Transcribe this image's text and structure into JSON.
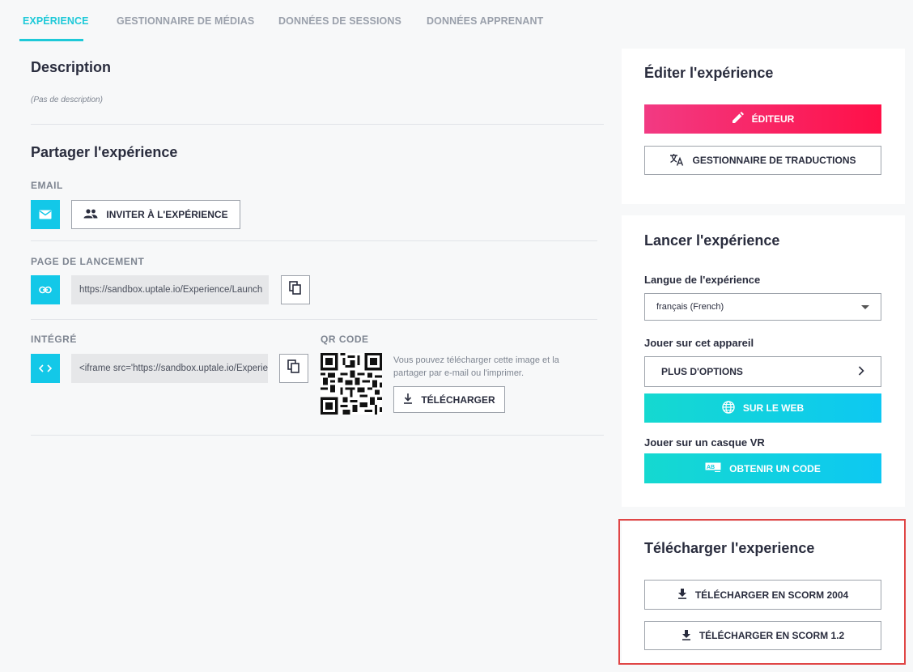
{
  "tabs": [
    {
      "label": "EXPÉRIENCE",
      "active": true
    },
    {
      "label": "GESTIONNAIRE DE MÉDIAS",
      "active": false
    },
    {
      "label": "DONNÉES DE SESSIONS",
      "active": false
    },
    {
      "label": "DONNÉES APPRENANT",
      "active": false
    }
  ],
  "description": {
    "title": "Description",
    "text": "(Pas de description)"
  },
  "share": {
    "title": "Partager l'expérience",
    "email_label": "EMAIL",
    "invite_label": "INVITER À L'EXPÉRIENCE",
    "launch_label": "PAGE DE LANCEMENT",
    "launch_url": "https://sandbox.uptale.io/Experience/Launch",
    "embed_label": "INTÉGRÉ",
    "embed_code": "<iframe src='https://sandbox.uptale.io/Experience",
    "qr_label": "QR CODE",
    "qr_help": "Vous pouvez télécharger cette image et la partager par e-mail ou l'imprimer.",
    "download_label": "TÉLÉCHARGER"
  },
  "edit_card": {
    "title": "Éditer l'expérience",
    "editor_label": "ÉDITEUR",
    "translations_label": "GESTIONNAIRE DE TRADUCTIONS"
  },
  "launch_card": {
    "title": "Lancer l'expérience",
    "language_label": "Langue de l'expérience",
    "language_value": "français (French)",
    "device_label": "Jouer sur cet appareil",
    "more_options_label": "PLUS D'OPTIONS",
    "web_label": "SUR LE WEB",
    "vr_label": "Jouer sur un casque VR",
    "code_label": "OBTENIR UN CODE"
  },
  "download_card": {
    "title": "Télécharger l'experience",
    "scorm2004_label": "TÉLÉCHARGER EN SCORM 2004",
    "scorm12_label": "TÉLÉCHARGER EN SCORM 1.2"
  },
  "colors": {
    "accent": "#1ec9d8",
    "pink": "#ff1048",
    "cyan": "#0dc8f2",
    "highlight": "#e04646"
  }
}
